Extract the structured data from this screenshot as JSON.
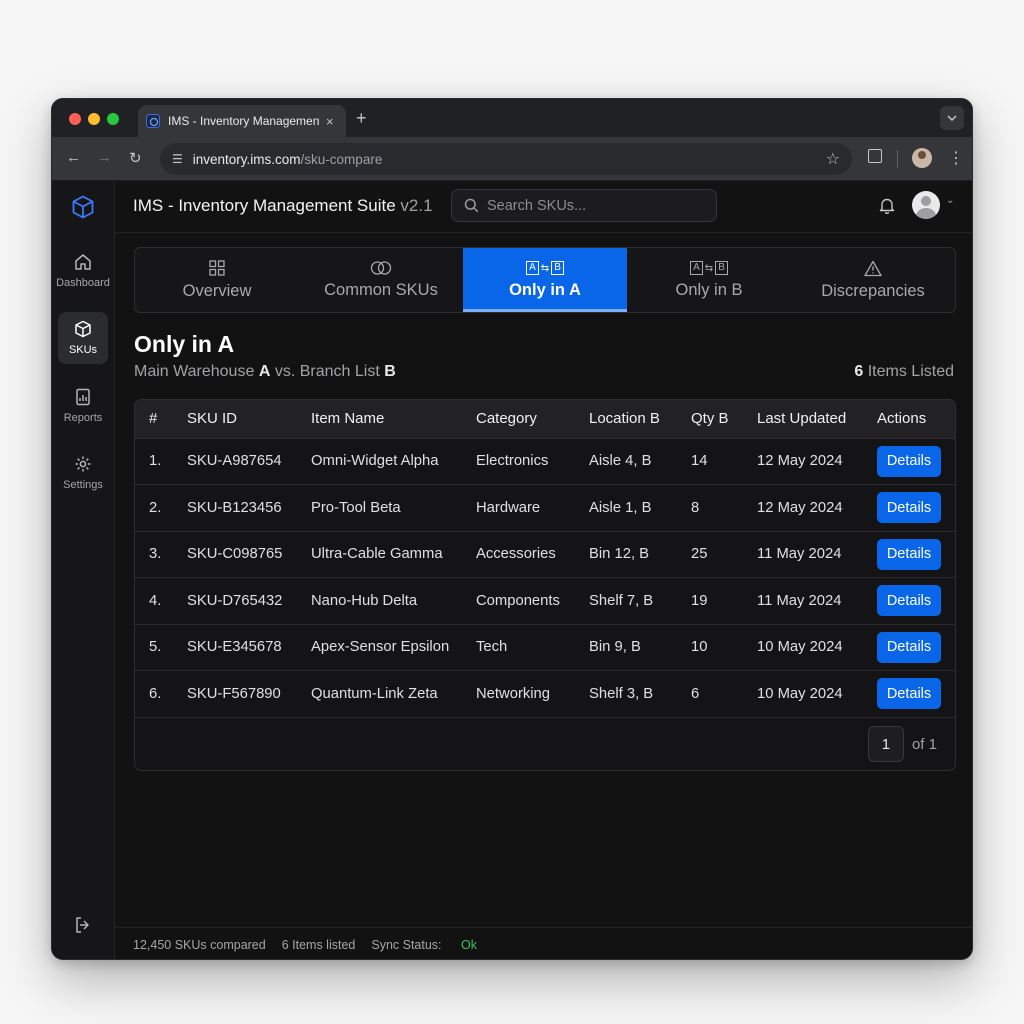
{
  "browser": {
    "tab_title": "IMS - Inventory Management Suite",
    "tab_close": "×",
    "new_tab": "+",
    "url_host": "inventory.ims.com",
    "url_path": "/sku-compare"
  },
  "rail": {
    "items": [
      {
        "label": "Dashboard",
        "icon": "home-icon"
      },
      {
        "label": "SKUs",
        "icon": "cube-icon",
        "active": true
      },
      {
        "label": "Reports",
        "icon": "report-icon"
      },
      {
        "label": "Settings",
        "icon": "gear-icon"
      }
    ]
  },
  "header": {
    "title": "IMS - Inventory Management Suite",
    "version": "v2.1",
    "search_placeholder": "Search SKUs..."
  },
  "tabs": [
    {
      "label": "Overview",
      "icon": "grid-icon"
    },
    {
      "label": "Common SKUs",
      "icon": "overlap-circles-icon"
    },
    {
      "label": "Only in A",
      "icon": "ab-compare-icon",
      "active": true
    },
    {
      "label": "Only in B",
      "icon": "ab-compare-icon"
    },
    {
      "label": "Discrepancies",
      "icon": "warning-icon"
    }
  ],
  "section": {
    "title": "Only in A",
    "sub_prefix": "Main Warehouse",
    "sub_a": "A",
    "sub_mid": "vs. Branch List",
    "sub_b": "B",
    "count_num": "6",
    "count_label": "Items Listed"
  },
  "table": {
    "columns": [
      "#",
      "SKU ID",
      "Item Name",
      "Category",
      "Location B",
      "Qty B",
      "Last Updated",
      "Actions"
    ],
    "rows": [
      {
        "num": "1.",
        "sku": "SKU-A987654",
        "name": "Omni-Widget Alpha",
        "category": "Electronics",
        "location": "Aisle 4, B",
        "qty": "14",
        "updated": "12 May 2024",
        "action": "Details"
      },
      {
        "num": "2.",
        "sku": "SKU-B123456",
        "name": "Pro-Tool Beta",
        "category": "Hardware",
        "location": "Aisle 1, B",
        "qty": "8",
        "updated": "12 May 2024",
        "action": "Details"
      },
      {
        "num": "3.",
        "sku": "SKU-C098765",
        "name": "Ultra-Cable Gamma",
        "category": "Accessories",
        "location": "Bin 12, B",
        "qty": "25",
        "updated": "11 May 2024",
        "action": "Details"
      },
      {
        "num": "4.",
        "sku": "SKU-D765432",
        "name": "Nano-Hub Delta",
        "category": "Components",
        "location": "Shelf 7, B",
        "qty": "19",
        "updated": "11 May 2024",
        "action": "Details"
      },
      {
        "num": "5.",
        "sku": "SKU-E345678",
        "name": "Apex-Sensor Epsilon",
        "category": "Tech",
        "location": "Bin 9, B",
        "qty": "10",
        "updated": "10 May 2024",
        "action": "Details"
      },
      {
        "num": "6.",
        "sku": "SKU-F567890",
        "name": "Quantum-Link Zeta",
        "category": "Networking",
        "location": "Shelf 3, B",
        "qty": "6",
        "updated": "10 May 2024",
        "action": "Details"
      }
    ]
  },
  "pager": {
    "page": "1",
    "of": "of 1"
  },
  "status": {
    "compared": "12,450 SKUs compared",
    "listed": "6 Items listed",
    "sync_label": "Sync Status:",
    "sync_value": "Ok"
  },
  "colors": {
    "accent": "#0a66e8",
    "ok": "#34c759"
  }
}
